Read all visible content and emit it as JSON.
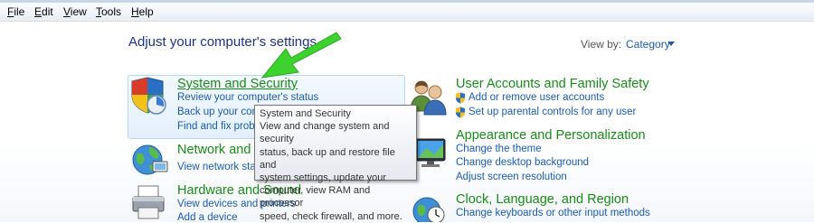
{
  "menu": [
    {
      "label": "File",
      "accel": "F",
      "rest": "ile"
    },
    {
      "label": "Edit",
      "accel": "E",
      "rest": "dit"
    },
    {
      "label": "View",
      "accel": "V",
      "rest": "iew"
    },
    {
      "label": "Tools",
      "accel": "T",
      "rest": "ools"
    },
    {
      "label": "Help",
      "accel": "H",
      "rest": "elp"
    }
  ],
  "page_title": "Adjust your computer's settings",
  "view_by": {
    "label": "View by:",
    "value": "Category"
  },
  "categories": {
    "system_security": {
      "title": "System and Security",
      "tasks": [
        "Review your computer's status",
        "Back up your com",
        "Find and fix proble"
      ]
    },
    "network": {
      "title": "Network and I",
      "tasks": [
        "View network statu"
      ]
    },
    "hardware": {
      "title": "Hardware and Sound",
      "tasks": [
        "View devices and printers",
        "Add a device"
      ]
    },
    "user_accounts": {
      "title": "User Accounts and Family Safety",
      "tasks": [
        "Add or remove user accounts",
        "Set up parental controls for any user"
      ]
    },
    "appearance": {
      "title": "Appearance and Personalization",
      "tasks": [
        "Change the theme",
        "Change desktop background",
        "Adjust screen resolution"
      ]
    },
    "clock": {
      "title": "Clock, Language, and Region",
      "tasks": [
        "Change keyboards or other input methods"
      ]
    }
  },
  "tooltip": {
    "title": "System and Security",
    "lines": [
      "View and change system and security",
      "status, back up and restore file and",
      "system settings, update your",
      "computer, view RAM and processor",
      "speed, check firewall, and more."
    ]
  },
  "colors": {
    "category_title": "#1a8a1a",
    "task_link": "#1b5cb0",
    "heading": "#1e3287",
    "annotation_arrow": "#3ed22f"
  },
  "icons": [
    "system-security-shield-icon",
    "network-globe-icon",
    "hardware-printer-icon",
    "user-accounts-icon",
    "appearance-monitor-icon",
    "clock-globe-icon",
    "uac-shield-icon",
    "green-arrow-annotation"
  ]
}
